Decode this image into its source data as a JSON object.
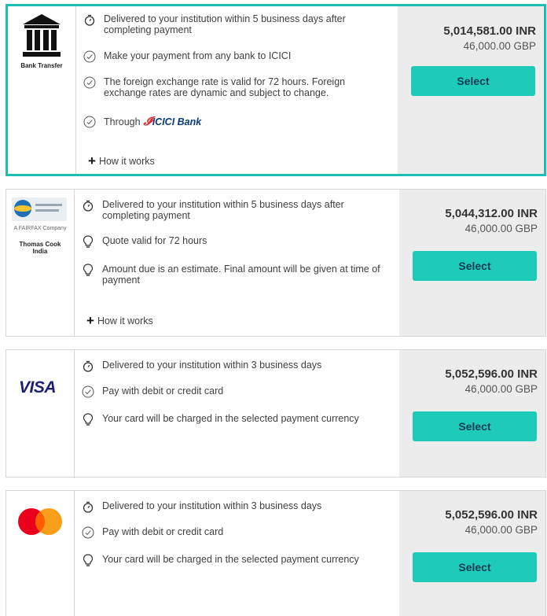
{
  "cards": [
    {
      "logo_caption": "Bank Transfer",
      "features": [
        "Delivered to your institution within 5 business days after completing payment",
        "Make your payment from any bank to ICICI",
        "The foreign exchange rate is valid for 72 hours. Foreign exchange rates are dynamic and subject to change.",
        "Through"
      ],
      "through_brand": "ICICI Bank",
      "how_it_works": "How it works",
      "price_inr": "5,014,581.00 INR",
      "price_gbp": "46,000.00 GBP",
      "select_label": "Select"
    },
    {
      "logo_caption": "Thomas Cook India",
      "logo_tagline": "A FAIRFAX Company",
      "features": [
        "Delivered to your institution within 5 business days after completing payment",
        "Quote valid for 72 hours",
        "Amount due is an estimate. Final amount will be given at time of payment"
      ],
      "how_it_works": "How it works",
      "price_inr": "5,044,312.00 INR",
      "price_gbp": "46,000.00 GBP",
      "select_label": "Select"
    },
    {
      "logo_text": "VISA",
      "features": [
        "Delivered to your institution within 3 business days",
        "Pay with debit or credit card",
        "Your card will be charged in the selected payment currency"
      ],
      "price_inr": "5,052,596.00 INR",
      "price_gbp": "46,000.00 GBP",
      "select_label": "Select"
    },
    {
      "features": [
        "Delivered to your institution within 3 business days",
        "Pay with debit or credit card",
        "Your card will be charged in the selected payment currency"
      ],
      "price_inr": "5,052,596.00 INR",
      "price_gbp": "46,000.00 GBP",
      "select_label": "Select"
    }
  ],
  "colors": {
    "accent": "#1ecbb9",
    "selected_border": "#1bbfb3",
    "price_panel": "#ececec"
  }
}
